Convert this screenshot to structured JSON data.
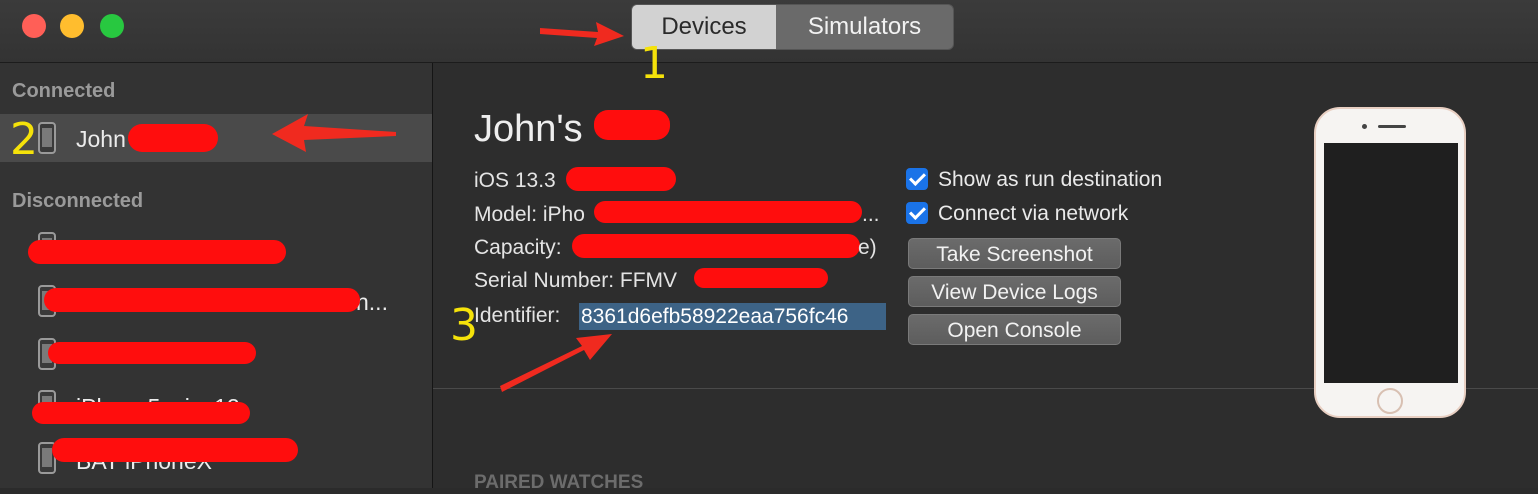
{
  "toolbar": {
    "segments": [
      {
        "label": "Devices",
        "active": true
      },
      {
        "label": "Simulators",
        "active": false
      }
    ]
  },
  "sidebar": {
    "connected_header": "Connected",
    "disconnected_header": "Disconnected",
    "connected_items": [
      {
        "label": "John"
      }
    ],
    "disconnected_items": [
      {
        "label": ""
      },
      {
        "label": "n..."
      },
      {
        "label": ""
      },
      {
        "label": "iPhone5s_ios12"
      },
      {
        "label": "BAT iPhoneX"
      }
    ]
  },
  "device": {
    "name": "John's",
    "ios_label": "iOS 13.3",
    "model_label": "Model: iPho",
    "model_tail": "...",
    "capacity_label": "Capacity:",
    "capacity_tail": "e)",
    "serial_label": "Serial Number: FFMV",
    "identifier_label": "Identifier:",
    "identifier_value": "8361d6efb58922eaa756fc46"
  },
  "options": {
    "show_as_run_destination": "Show as run destination",
    "connect_via_network": "Connect via network"
  },
  "buttons": {
    "take_screenshot": "Take Screenshot",
    "view_device_logs": "View Device Logs",
    "open_console": "Open Console"
  },
  "sections": {
    "paired_watches": "PAIRED WATCHES"
  },
  "annotations": {
    "one": "1",
    "two": "2",
    "three": "3"
  },
  "colors": {
    "accent": "#1a73e8",
    "selection": "#3d6386",
    "annotation": "#f5e20a",
    "redaction": "#ff0d0d",
    "arrow": "#f02a1f"
  }
}
